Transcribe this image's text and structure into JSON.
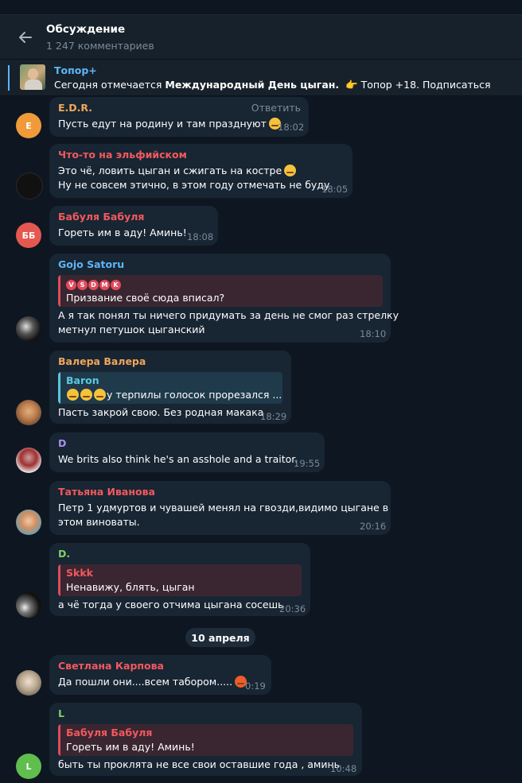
{
  "header": {
    "title": "Обсуждение",
    "subtitle": "1 247 комментариев"
  },
  "pinned": {
    "channel": "Топор+",
    "text_before": "Сегодня отмечается ",
    "text_bold": "Международный День цыган.",
    "text_after": "👉 Топор +18. Подписаться"
  },
  "date_separator": "10 апреля",
  "messages": [
    {
      "id": "edr",
      "author": "E.D.R.",
      "author_color": "#f0a65a",
      "avatar_initials": "E",
      "avatar_color": "#f19a3a",
      "reply_action": "Ответить",
      "lines": [
        "Пусть едут на родину и там празднуют"
      ],
      "emoji": "smirk-emoji",
      "time": "18:02"
    },
    {
      "id": "elf",
      "author": "Что-то на эльфийском",
      "author_color": "#f2595d",
      "avatar_initials": "",
      "avatar_color": "#1c1c1c",
      "lines": [
        "Это чё, ловить цыган и сжигать на костре",
        "Ну не совсем этично, в этом году отмечать не буду"
      ],
      "emoji": "thinking-emoji",
      "time": "18:05"
    },
    {
      "id": "babulya",
      "author": "Бабуля Бабуля",
      "author_color": "#f2595d",
      "avatar_initials": "ББ",
      "avatar_color": "#e5584f",
      "lines": [
        "Гореть им в аду! Аминь!"
      ],
      "time": "18:08"
    },
    {
      "id": "gojo",
      "author": "Gojo Satoru",
      "author_color": "#5eb5f7",
      "avatar_initials": "",
      "avatar_color": "#2a2a2a",
      "quote": {
        "author_tags": [
          "V",
          "S",
          "D",
          "M",
          "K"
        ],
        "text": "Призвание своё сюда вписал?",
        "color": "#e14a5b"
      },
      "lines": [
        "А я так понял ты ничего придумать за день не смог раз стрелку",
        "метнул петушок цыганский"
      ],
      "time": "18:10"
    },
    {
      "id": "valera",
      "author": "Валера Валера",
      "author_color": "#f0a65a",
      "avatar_initials": "",
      "avatar_color": "#8a6a3e",
      "quote": {
        "author": "Baron",
        "text": "у терпилы голосок прорезался ...",
        "color": "#5ac8e0"
      },
      "lines": [
        "Пасть закрой свою. Без родная макака"
      ],
      "time": "18:29"
    },
    {
      "id": "d",
      "author": "D",
      "author_color": "#a98ef0",
      "avatar_initials": "",
      "avatar_color": "#5a6a7a",
      "lines": [
        "We brits also think he's an asshole and a traitor."
      ],
      "time": "19:55"
    },
    {
      "id": "tatiana",
      "author": "Татьяна Иванова",
      "author_color": "#f2595d",
      "avatar_initials": "",
      "avatar_color": "#b98a6a",
      "lines": [
        "Петр 1 удмуртов и чувашей менял на гвозди,видимо цыгане в",
        "этом виноваты."
      ],
      "time": "20:16"
    },
    {
      "id": "dpoint",
      "author": "D.",
      "author_color": "#7cd16a",
      "avatar_initials": "",
      "avatar_color": "#202020",
      "quote": {
        "author": "Skkk",
        "text": "Ненавижу, блять, цыган",
        "color": "#e14a5b"
      },
      "lines": [
        "а чё тогда у своего отчима цыгана сосешь"
      ],
      "time": "20:36"
    },
    {
      "id": "svetlana",
      "author": "Светлана Карпова",
      "author_color": "#f2595d",
      "avatar_initials": "",
      "avatar_color": "#a8a090",
      "lines": [
        "Да пошли они....всем табором....."
      ],
      "emoji": "angry-emoji",
      "time": "0:19"
    },
    {
      "id": "l",
      "author": "L",
      "author_color": "#7cd16a",
      "avatar_initials": "L",
      "avatar_color": "#5fbe4e",
      "quote": {
        "author": "Бабуля Бабуля",
        "text": "Гореть им в аду! Аминь!",
        "color": "#e14a5b"
      },
      "lines": [
        "быть ты проклята не все свои оставшие года , аминь"
      ],
      "time": "10:48"
    }
  ]
}
